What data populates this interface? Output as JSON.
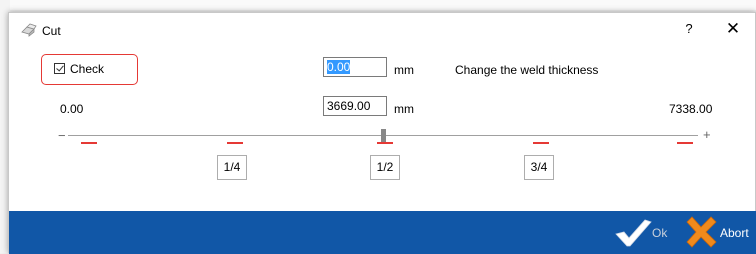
{
  "window": {
    "title": "Cut",
    "help_label": "?",
    "close_label": "✕"
  },
  "check": {
    "label": "Check",
    "checked": true
  },
  "weld_thickness": {
    "value": "0.00",
    "unit": "mm",
    "hint": "Change the weld thickness"
  },
  "slider": {
    "min_label": "0.00",
    "max_label": "7338.00",
    "position_value": "3669.00",
    "unit": "mm",
    "minus": "−",
    "plus": "+",
    "fraction": 0.5
  },
  "fractions": {
    "quarter": "1/4",
    "half": "1/2",
    "three_quarter": "3/4"
  },
  "footer": {
    "ok_label": "Ok",
    "abort_label": "Abort"
  },
  "colors": {
    "footer_bg": "#1157a7",
    "highlight": "#e53935",
    "selection": "#3399ff"
  },
  "icons": {
    "app": "cut-tool-icon",
    "ok": "checkmark-icon",
    "abort": "cross-icon"
  }
}
